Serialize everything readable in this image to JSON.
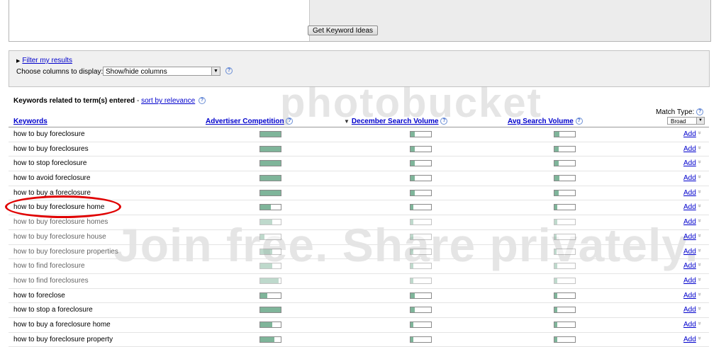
{
  "top": {
    "button_label": "Get Keyword Ideas"
  },
  "filter": {
    "link_label": "Filter my results",
    "columns_label": "Choose columns to display:",
    "columns_value": "Show/hide columns"
  },
  "watermarks": {
    "line1": "photobucket",
    "line2": "Join free. Share privately."
  },
  "results": {
    "heading": "Keywords related to term(s) entered",
    "heading_sep": " - ",
    "sort_link": "sort by relevance",
    "match_type_label": "Match Type:",
    "match_type_value": "Broad",
    "columns": {
      "keywords": "Keywords",
      "competition": "Advertiser Competition",
      "december": "December Search Volume",
      "avg": "Avg Search Volume"
    },
    "add_label": "Add",
    "rows": [
      {
        "keyword": "how to buy foreclosure",
        "competition": 1.0,
        "december": 0.2,
        "avg": 0.25,
        "dim": false
      },
      {
        "keyword": "how to buy foreclosures",
        "competition": 1.0,
        "december": 0.2,
        "avg": 0.2,
        "dim": false
      },
      {
        "keyword": "how to stop foreclosure",
        "competition": 1.0,
        "december": 0.2,
        "avg": 0.2,
        "dim": false
      },
      {
        "keyword": "how to avoid foreclosure",
        "competition": 1.0,
        "december": 0.2,
        "avg": 0.25,
        "dim": false
      },
      {
        "keyword": "how to buy a foreclosure",
        "competition": 1.0,
        "december": 0.2,
        "avg": 0.2,
        "dim": false
      },
      {
        "keyword": "how to buy foreclosure home",
        "competition": 0.5,
        "december": 0.15,
        "avg": 0.15,
        "dim": false
      },
      {
        "keyword": "how to buy foreclosure homes",
        "competition": 0.6,
        "december": 0.15,
        "avg": 0.15,
        "dim": true
      },
      {
        "keyword": "how to buy foreclosure house",
        "competition": 0.2,
        "december": 0.15,
        "avg": 0.1,
        "dim": true
      },
      {
        "keyword": "how to buy foreclosure properties",
        "competition": 0.6,
        "december": 0.15,
        "avg": 0.1,
        "dim": true
      },
      {
        "keyword": "how to find foreclosure",
        "competition": 0.6,
        "december": 0.15,
        "avg": 0.15,
        "dim": true
      },
      {
        "keyword": "how to find foreclosures",
        "competition": 0.9,
        "december": 0.15,
        "avg": 0.15,
        "dim": true
      },
      {
        "keyword": "how to foreclose",
        "competition": 0.35,
        "december": 0.2,
        "avg": 0.15,
        "dim": false
      },
      {
        "keyword": "how to stop a foreclosure",
        "competition": 1.0,
        "december": 0.2,
        "avg": 0.15,
        "dim": false
      },
      {
        "keyword": "how to buy a foreclosure home",
        "competition": 0.6,
        "december": 0.15,
        "avg": 0.15,
        "dim": false
      },
      {
        "keyword": "how to buy foreclosure property",
        "competition": 0.7,
        "december": 0.15,
        "avg": 0.15,
        "dim": false
      }
    ]
  }
}
